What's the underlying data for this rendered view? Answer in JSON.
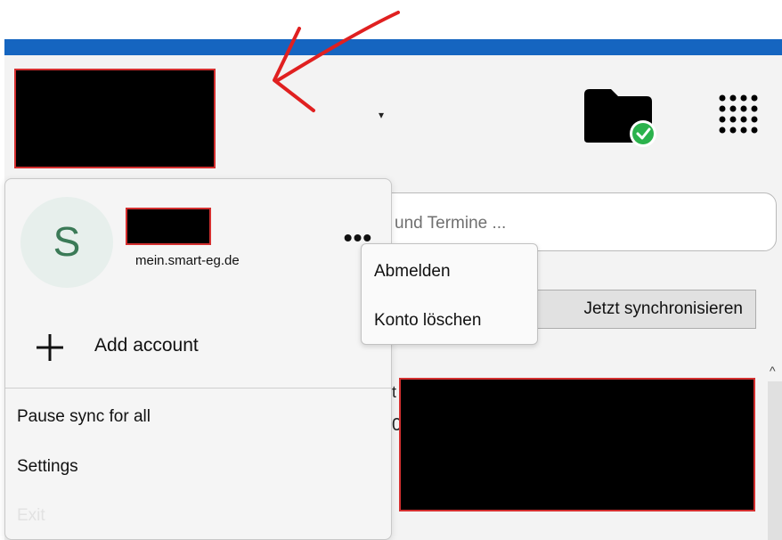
{
  "search": {
    "placeholder": "und Termine ..."
  },
  "toolbar": {
    "sync_label": "Jetzt synchronisieren"
  },
  "header": {
    "dropdown_glyph": "▾"
  },
  "account_panel": {
    "avatar_letter": "S",
    "account_domain": "mein.smart-eg.de",
    "more_label": "•••",
    "add_account_label": "Add account",
    "menu_items": [
      "Pause sync for all",
      "Settings",
      "Exit"
    ]
  },
  "context_menu": {
    "items": [
      "Abmelden",
      "Konto löschen"
    ]
  },
  "colors": {
    "brand_bar": "#1565c0",
    "annotation": "#e02020",
    "sync_ok": "#2bb24c",
    "avatar_letter": "#3b7a57"
  }
}
